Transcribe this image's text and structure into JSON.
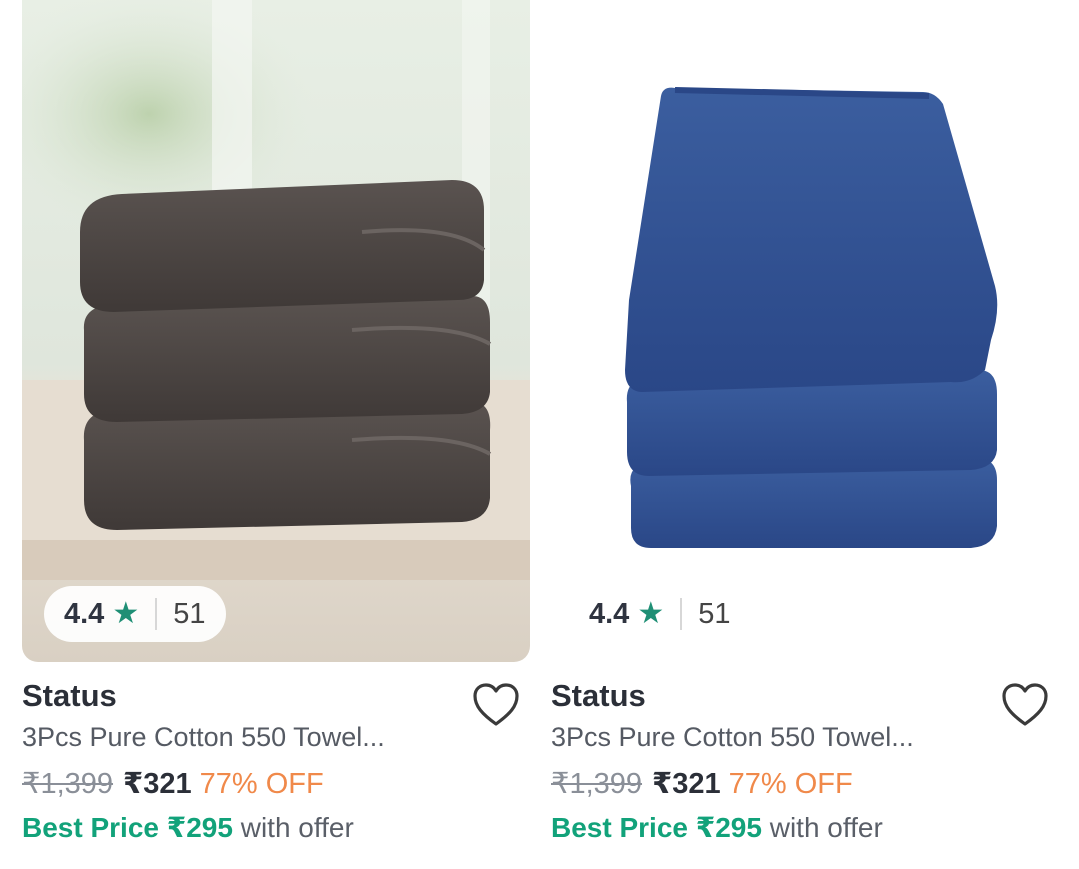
{
  "products": [
    {
      "rating": "4.4",
      "reviews": "51",
      "brand": "Status",
      "title": "3Pcs Pure Cotton 550 Towel...",
      "mrp": "₹1,399",
      "price": "₹321",
      "discount": "77% OFF",
      "best_price": "Best Price ₹295",
      "best_suffix": "with offer",
      "towel_color": "#4a4442",
      "bg_color": "#e9ece6"
    },
    {
      "rating": "4.4",
      "reviews": "51",
      "brand": "Status",
      "title": "3Pcs Pure Cotton 550 Towel...",
      "mrp": "₹1,399",
      "price": "₹321",
      "discount": "77% OFF",
      "best_price": "Best Price ₹295",
      "best_suffix": "with offer",
      "towel_color": "#2f4f8f",
      "bg_color": "#ffffff"
    }
  ],
  "colors": {
    "star": "#1f8f75",
    "discount": "#f0894a",
    "best_price": "#12a27a"
  },
  "icons": {
    "star": "star-icon",
    "wishlist": "heart-outline-icon"
  }
}
